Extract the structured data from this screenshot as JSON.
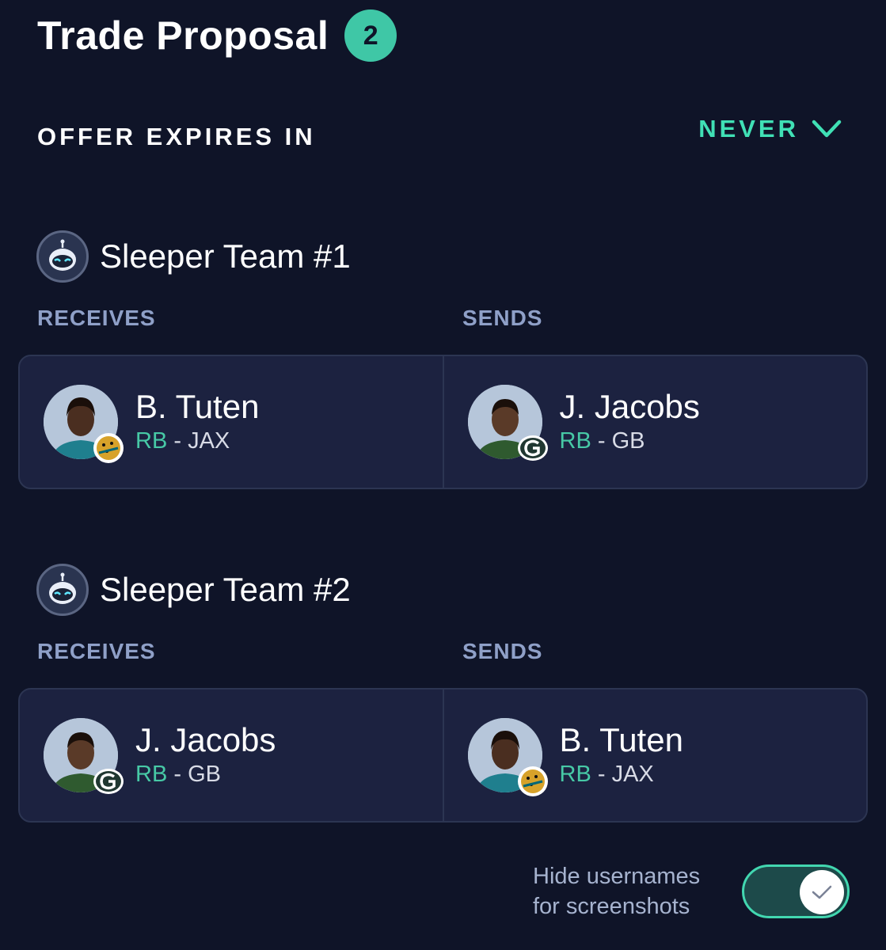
{
  "header": {
    "title": "Trade Proposal",
    "badge_count": "2"
  },
  "expiry": {
    "label": "OFFER EXPIRES IN",
    "value": "NEVER"
  },
  "teams": [
    {
      "name": "Sleeper Team #1",
      "receives_label": "RECEIVES",
      "sends_label": "SENDS",
      "receives": {
        "name": "B. Tuten",
        "position": "RB",
        "separator": " - ",
        "team": "JAX"
      },
      "sends": {
        "name": "J. Jacobs",
        "position": "RB",
        "separator": " - ",
        "team": "GB"
      }
    },
    {
      "name": "Sleeper Team #2",
      "receives_label": "RECEIVES",
      "sends_label": "SENDS",
      "receives": {
        "name": "J. Jacobs",
        "position": "RB",
        "separator": " - ",
        "team": "GB"
      },
      "sends": {
        "name": "B. Tuten",
        "position": "RB",
        "separator": " - ",
        "team": "JAX"
      }
    }
  ],
  "settings": {
    "hide_usernames_label": "Hide usernames for screenshots",
    "hide_usernames_on": true
  },
  "colors": {
    "accent": "#40e0b5",
    "background": "#0f1428",
    "card": "#1c2240"
  },
  "icons": {
    "expiry": "chevron-down-icon",
    "team": "sleeper-bot-icon",
    "toggle": "check-icon"
  }
}
